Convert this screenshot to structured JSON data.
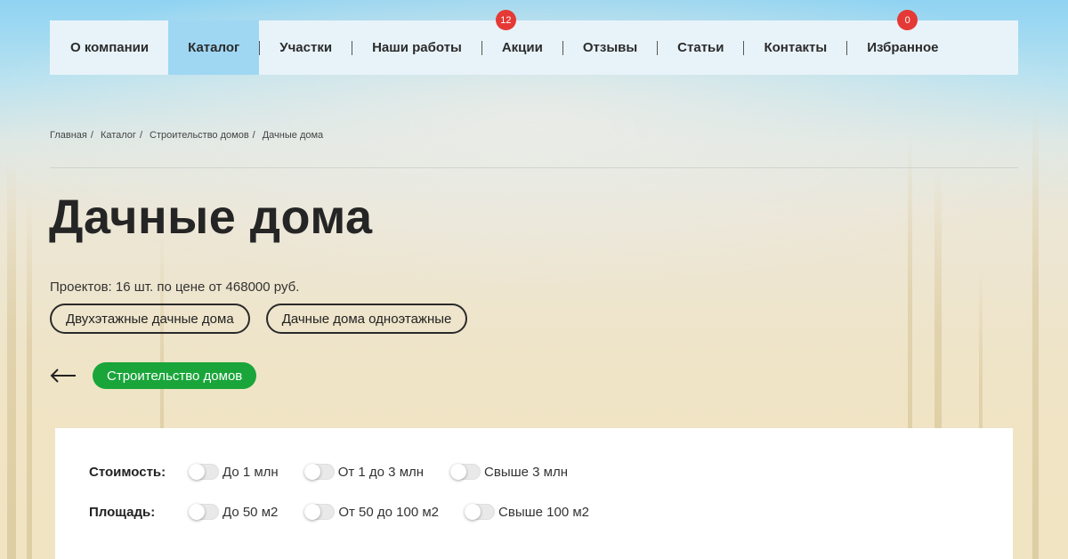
{
  "nav": {
    "items": [
      {
        "label": "О компании"
      },
      {
        "label": "Каталог"
      },
      {
        "label": "Участки"
      },
      {
        "label": "Наши работы"
      },
      {
        "label": "Акции",
        "badge": "12"
      },
      {
        "label": "Отзывы"
      },
      {
        "label": "Статьи"
      },
      {
        "label": "Контакты"
      },
      {
        "label": "Избранное",
        "badge": "0"
      }
    ],
    "active": "Каталог"
  },
  "breadcrumb": {
    "items": [
      "Главная",
      "Каталог",
      "Строительство домов",
      "Дачные дома"
    ],
    "separator": "/"
  },
  "page": {
    "title": "Дачные дома",
    "summary": "Проектов: 16 шт. по цене от 468000 руб."
  },
  "subcategories": [
    "Двухэтажные дачные дома",
    "Дачные дома одноэтажные"
  ],
  "parent_category": {
    "label": "Строительство домов",
    "back_icon": "arrow-left-icon"
  },
  "filters": {
    "cost": {
      "label": "Стоимость:",
      "options": [
        "До 1 млн",
        "От 1 до 3 млн",
        "Свыше 3 млн"
      ]
    },
    "area": {
      "label": "Площадь:",
      "options": [
        "До 50 м2",
        "От 50 до 100 м2",
        "Свыше 100 м2"
      ]
    }
  },
  "colors": {
    "accent_green": "#1aa53a",
    "active_tab": "#9fd7f3",
    "badge_red": "#e53935"
  }
}
